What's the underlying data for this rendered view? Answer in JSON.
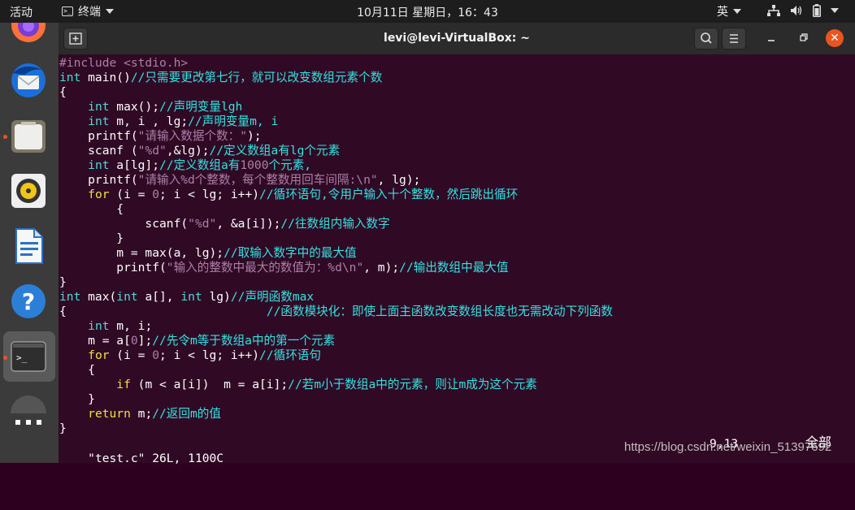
{
  "topbar": {
    "activities": "活动",
    "app_menu": "终端",
    "clock": "10月11日 星期日，16：43",
    "input_method": "英"
  },
  "window": {
    "title": "levi@levi-VirtualBox: ~"
  },
  "editor": {
    "lines": [
      [
        {
          "t": "#include <stdio.h>",
          "c": "pp"
        }
      ],
      [
        {
          "t": "int",
          "c": "ty"
        },
        {
          "t": " main()"
        },
        {
          "t": "//只需要更改第七行，就可以改变数组元素个数",
          "c": "cm"
        }
      ],
      [
        {
          "t": "{"
        }
      ],
      [
        {
          "t": "    "
        },
        {
          "t": "int",
          "c": "ty"
        },
        {
          "t": " max();"
        },
        {
          "t": "//声明变量lgh",
          "c": "cm"
        }
      ],
      [
        {
          "t": "    "
        },
        {
          "t": "int",
          "c": "ty"
        },
        {
          "t": " m, i , lg;"
        },
        {
          "t": "//声明变量m, i",
          "c": "cm"
        }
      ],
      [
        {
          "t": "    printf("
        },
        {
          "t": "\"请输入数据个数：\"",
          "c": "st"
        },
        {
          "t": ");"
        }
      ],
      [
        {
          "t": "    scanf ("
        },
        {
          "t": "\"%d\"",
          "c": "st"
        },
        {
          "t": ",&lg);"
        },
        {
          "t": "//定义数组a有lg个元素",
          "c": "cm"
        }
      ],
      [
        {
          "t": "    "
        },
        {
          "t": "int",
          "c": "ty"
        },
        {
          "t": " a[lg];"
        },
        {
          "t": "//定义数组a有",
          "c": "cm"
        },
        {
          "t": "1000",
          "c": "nm"
        },
        {
          "t": "个元素,",
          "c": "cm"
        }
      ],
      [
        {
          "t": "    printf("
        },
        {
          "t": "\"请输入%d个整数，每个整数用回车间隔:\\n\"",
          "c": "st"
        },
        {
          "t": ", lg);"
        }
      ],
      [
        {
          "t": "    "
        },
        {
          "t": "for",
          "c": "kw"
        },
        {
          "t": " (i = "
        },
        {
          "t": "0",
          "c": "nm"
        },
        {
          "t": "; i < lg; i++)"
        },
        {
          "t": "//循环语句,令用户输入十个整数，然后跳出循环",
          "c": "cm"
        }
      ],
      [
        {
          "t": "        {"
        }
      ],
      [
        {
          "t": "            scanf("
        },
        {
          "t": "\"%d\"",
          "c": "st"
        },
        {
          "t": ", &a[i]);"
        },
        {
          "t": "//往数组内输入数字",
          "c": "cm"
        }
      ],
      [
        {
          "t": "        }"
        }
      ],
      [
        {
          "t": "        m = max(a, lg);"
        },
        {
          "t": "//取输入数字中的最大值",
          "c": "cm"
        }
      ],
      [
        {
          "t": "        printf("
        },
        {
          "t": "\"输入的整数中最大的数值为：%d\\n\"",
          "c": "st"
        },
        {
          "t": ", m);"
        },
        {
          "t": "//输出数组中最大值",
          "c": "cm"
        }
      ],
      [
        {
          "t": "}"
        }
      ],
      [
        {
          "t": "int",
          "c": "ty"
        },
        {
          "t": " max("
        },
        {
          "t": "int",
          "c": "ty"
        },
        {
          "t": " a[], "
        },
        {
          "t": "int",
          "c": "ty"
        },
        {
          "t": " lg)"
        },
        {
          "t": "//声明函数max",
          "c": "cm"
        }
      ],
      [
        {
          "t": "{                            "
        },
        {
          "t": "//函数模块化：即使上面主函数改变数组长度也无需改动下列函数",
          "c": "cm"
        }
      ],
      [
        {
          "t": "    "
        },
        {
          "t": "int",
          "c": "ty"
        },
        {
          "t": " m, i;"
        }
      ],
      [
        {
          "t": "    m = a["
        },
        {
          "t": "0",
          "c": "nm"
        },
        {
          "t": "];"
        },
        {
          "t": "//先令m等于数组a中的第一个元素",
          "c": "cm"
        }
      ],
      [
        {
          "t": "    "
        },
        {
          "t": "for",
          "c": "kw"
        },
        {
          "t": " (i = "
        },
        {
          "t": "0",
          "c": "nm"
        },
        {
          "t": "; i < lg; i++)"
        },
        {
          "t": "//循环语句",
          "c": "cm"
        }
      ],
      [
        {
          "t": "    {"
        }
      ],
      [
        {
          "t": "        "
        },
        {
          "t": "if",
          "c": "kw"
        },
        {
          "t": " (m < a[i])  m = a[i];"
        },
        {
          "t": "//若m小于数组a中的元素，则让m成为这个元素",
          "c": "cm"
        }
      ],
      [
        {
          "t": "    }"
        }
      ],
      [
        {
          "t": "    "
        },
        {
          "t": "return",
          "c": "kw"
        },
        {
          "t": " m;"
        },
        {
          "t": "//返回m的值",
          "c": "cm"
        }
      ],
      [
        {
          "t": "}"
        }
      ]
    ],
    "status_file": "\"test.c\" 26L, 1100C",
    "status_pos": "9,13",
    "status_all": "全部"
  },
  "watermark": "https://blog.csdn.net/weixin_51397692",
  "colors": {
    "terminal_bg": "#300a24",
    "accent": "#e95420"
  }
}
